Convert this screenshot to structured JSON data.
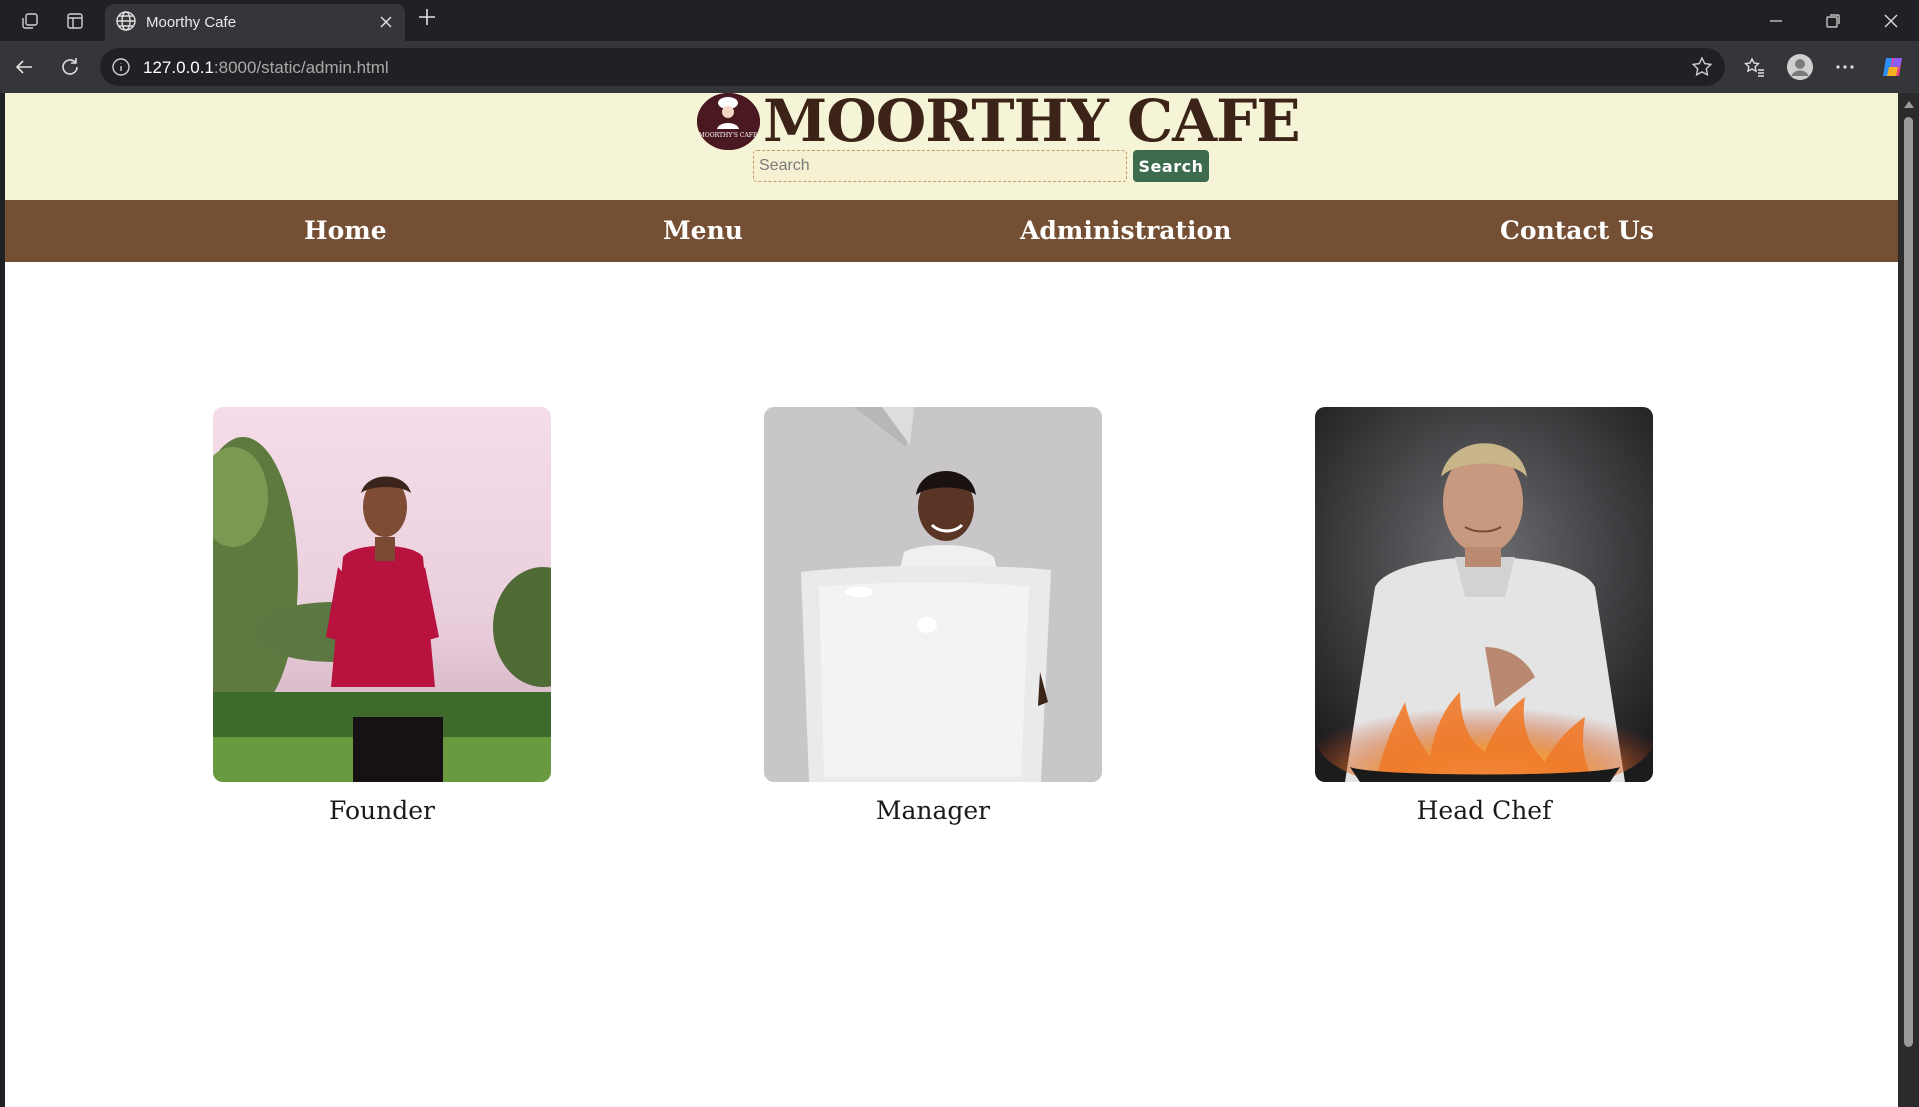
{
  "browser": {
    "tab_title": "Moorthy Cafe",
    "url_host": "127.0.0.1",
    "url_rest": ":8000/static/admin.html"
  },
  "site": {
    "brand": "MOORTHY CAFE",
    "logo_text": "MOORTHY'S CAFE",
    "search_placeholder": "Search",
    "search_button": "Search",
    "nav": [
      "Home",
      "Menu",
      "Administration",
      "Contact Us"
    ]
  },
  "team": [
    {
      "role": "Founder"
    },
    {
      "role": "Manager"
    },
    {
      "role": "Head Chef"
    }
  ],
  "colors": {
    "header_bg": "#f6f4d7",
    "nav_bg": "#744f33",
    "brand_text": "#3b2417",
    "search_button_bg": "#3d6b4e"
  }
}
